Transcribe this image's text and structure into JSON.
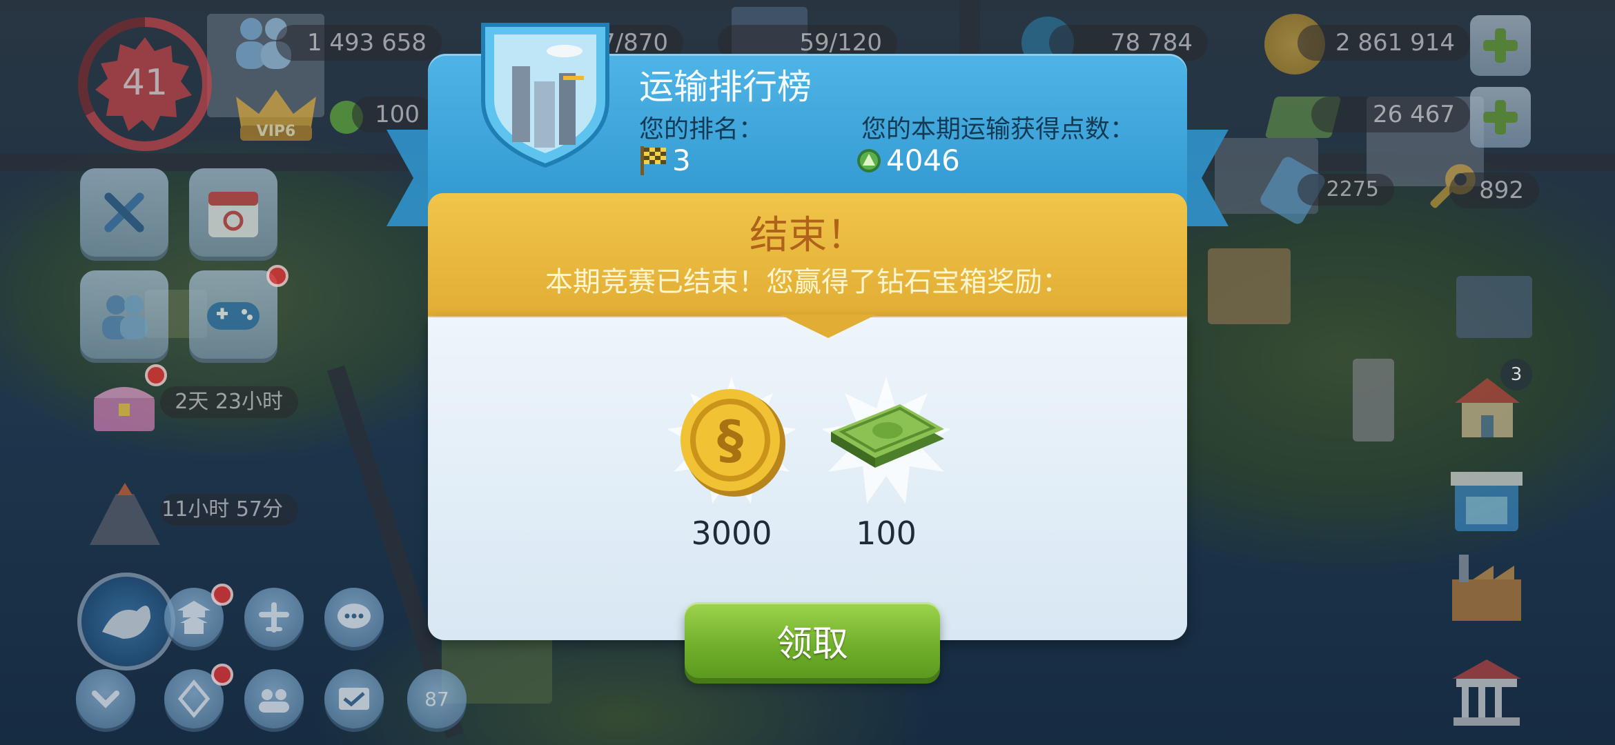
{
  "hud": {
    "level": "41",
    "population": "1 493 658",
    "capacity_a": "7/870",
    "capacity_b": "59/120",
    "neosimoleons": "78 784",
    "simoleons": "2 861 914",
    "simcash": "26 467",
    "happiness": "100",
    "vip_label": "VIP6",
    "tokens": "2275",
    "keys": "892",
    "chest_timer": "2天 23小时",
    "disaster_timer": "11小时 57分",
    "badge_count": "3",
    "bottom_icon_number": "87"
  },
  "modal": {
    "title": "运输排行榜",
    "rank_label": "您的排名：",
    "rank_value": "3",
    "points_label": "您的本期运输获得点数：",
    "points_value": "4046",
    "end_title": "结束！",
    "end_desc": "本期竞赛已结束！您赢得了钻石宝箱奖励：",
    "rewards": [
      {
        "icon": "simoleon-coin-icon",
        "amount": "3000"
      },
      {
        "icon": "simcash-bills-icon",
        "amount": "100"
      }
    ],
    "claim_label": "领取"
  },
  "colors": {
    "header_blue": "#3aa6dc",
    "banner_gold": "#e9b73f",
    "claim_green": "#7dbb33",
    "end_title_brown": "#b0621b"
  }
}
